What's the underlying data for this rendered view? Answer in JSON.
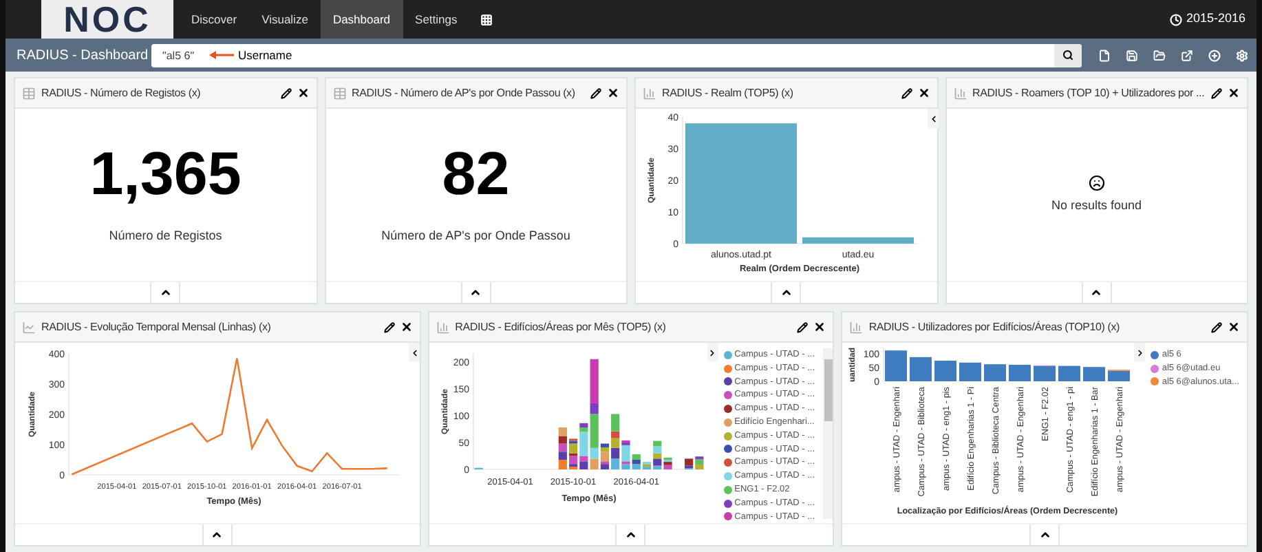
{
  "nav": {
    "logo": "NOC",
    "items": [
      {
        "label": "Discover",
        "selected": false
      },
      {
        "label": "Visualize",
        "selected": false
      },
      {
        "label": "Dashboard",
        "selected": true
      },
      {
        "label": "Settings",
        "selected": false
      }
    ],
    "time_range": "2015-2016"
  },
  "toolbar": {
    "title": "RADIUS - Dashboard",
    "search_value": "\"al5 6\"",
    "annotation": "Username"
  },
  "panels": [
    {
      "kind": "metric",
      "title": "RADIUS - Número de Registos (x)",
      "value": "1,365",
      "label": "Número de Registos"
    },
    {
      "kind": "metric",
      "title": "RADIUS - Número de AP's por Onde Passou (x)",
      "value": "82",
      "label": "Número de AP's por Onde Passou"
    },
    {
      "kind": "bar",
      "title": "RADIUS - Realm (TOP5) (x)",
      "chart_data": {
        "type": "bar",
        "xlabel": "Realm (Ordem Decrescente)",
        "ylabel": "Quantidade",
        "categories": [
          "alunos.utad.pt",
          "utad.eu"
        ],
        "values": [
          38,
          2
        ],
        "ylim": [
          0,
          40
        ],
        "yticks": [
          0,
          10,
          20,
          30,
          40
        ]
      }
    },
    {
      "kind": "empty",
      "title": "RADIUS - Roamers (TOP 10) + Utilizadores por ...",
      "message": "No results found"
    },
    {
      "kind": "line",
      "title": "RADIUS - Evolução Temporal Mensal (Linhas) (x)",
      "chart_data": {
        "type": "line",
        "xlabel": "Tempo (Mês)",
        "ylabel": "Quantidade",
        "categories": [
          null,
          null,
          null,
          "2015-04-01",
          null,
          null,
          "2015-07-01",
          null,
          null,
          "2015-10-01",
          null,
          null,
          "2016-01-01",
          null,
          null,
          "2016-04-01",
          null,
          null,
          "2016-07-01",
          null,
          null,
          null
        ],
        "values": [
          2,
          null,
          null,
          null,
          null,
          null,
          null,
          null,
          170,
          110,
          135,
          385,
          88,
          182,
          97,
          30,
          12,
          72,
          20,
          20,
          20,
          22
        ],
        "ylim": [
          0,
          400
        ],
        "yticks": [
          0,
          100,
          200,
          300,
          400
        ]
      }
    },
    {
      "kind": "time_bars",
      "title": "RADIUS - Edifícios/Áreas por Mês (TOP5) (x)",
      "chart_data": {
        "type": "bar",
        "stacked": true,
        "xlabel": "Tempo (Mês)",
        "ylabel": "Quantidade",
        "categories": [
          null,
          null,
          null,
          "2015-04-01",
          null,
          null,
          null,
          null,
          null,
          "2015-10-01",
          null,
          null,
          null,
          null,
          null,
          "2016-04-01",
          null,
          null,
          null,
          null,
          null,
          null
        ],
        "ylim": [
          0,
          215
        ],
        "yticks": [
          0,
          50,
          100,
          150,
          200
        ],
        "series": [
          {
            "name": "Campus - UTAD - ...",
            "color": "#5ab4d6",
            "values": [
              3,
              0,
              0,
              0,
              0,
              0,
              0,
              0,
              0,
              0,
              0,
              0,
              0,
              20,
              10,
              10,
              5,
              7,
              0,
              0,
              2,
              0
            ]
          },
          {
            "name": "Campus - UTAD - ...",
            "color": "#f07d2d",
            "values": [
              0,
              0,
              0,
              0,
              0,
              0,
              0,
              0,
              18,
              5,
              0,
              0,
              0,
              0,
              0,
              0,
              0,
              0,
              0,
              0,
              0,
              0
            ]
          },
          {
            "name": "Campus - UTAD - ...",
            "color": "#5b3fa8",
            "values": [
              0,
              0,
              0,
              0,
              0,
              0,
              0,
              0,
              15,
              5,
              15,
              0,
              10,
              20,
              0,
              0,
              0,
              13,
              0,
              0,
              5,
              0
            ]
          },
          {
            "name": "Campus - UTAD - ...",
            "color": "#c94fc0",
            "values": [
              0,
              0,
              0,
              0,
              0,
              0,
              0,
              0,
              15,
              15,
              10,
              0,
              5,
              0,
              5,
              0,
              0,
              0,
              8,
              0,
              0,
              0
            ]
          },
          {
            "name": "Campus - UTAD - ...",
            "color": "#9e2a2a",
            "values": [
              0,
              0,
              0,
              0,
              0,
              0,
              0,
              0,
              14,
              5,
              0,
              0,
              0,
              0,
              0,
              0,
              0,
              0,
              6,
              0,
              13,
              0
            ]
          },
          {
            "name": "Edifício Engenhari...",
            "color": "#e0a060",
            "values": [
              0,
              0,
              0,
              0,
              0,
              0,
              0,
              0,
              16,
              0,
              0,
              20,
              18,
              0,
              0,
              0,
              0,
              0,
              0,
              0,
              0,
              0
            ]
          },
          {
            "name": "Campus - UTAD - ...",
            "color": "#b5b02e",
            "values": [
              0,
              0,
              0,
              0,
              0,
              0,
              0,
              0,
              0,
              18,
              0,
              0,
              8,
              18,
              0,
              0,
              4,
              10,
              0,
              0,
              0,
              9
            ]
          },
          {
            "name": "Campus - UTAD - ...",
            "color": "#3a4fb0",
            "values": [
              0,
              0,
              0,
              0,
              0,
              0,
              0,
              0,
              0,
              5,
              0,
              0,
              7,
              0,
              0,
              8,
              0,
              0,
              0,
              0,
              0,
              0
            ]
          },
          {
            "name": "Campus - UTAD - ...",
            "color": "#d0503a",
            "values": [
              0,
              0,
              0,
              0,
              0,
              0,
              0,
              0,
              0,
              4,
              0,
              0,
              0,
              13,
              0,
              0,
              0,
              0,
              0,
              0,
              0,
              0
            ]
          },
          {
            "name": "Campus - UTAD - ...",
            "color": "#7fd6e6",
            "values": [
              0,
              0,
              0,
              0,
              0,
              0,
              0,
              0,
              0,
              0,
              45,
              20,
              0,
              0,
              30,
              0,
              5,
              13,
              4,
              0,
              0,
              0
            ]
          },
          {
            "name": "ENG1 - F2.02",
            "color": "#5cc05c",
            "values": [
              0,
              0,
              0,
              0,
              0,
              0,
              0,
              0,
              0,
              0,
              8,
              63,
              0,
              32,
              0,
              10,
              0,
              10,
              4,
              0,
              0,
              10
            ]
          },
          {
            "name": "Campus - UTAD - ...",
            "color": "#7b3fbf",
            "values": [
              0,
              0,
              0,
              0,
              0,
              0,
              0,
              0,
              0,
              0,
              8,
              20,
              0,
              0,
              5,
              0,
              0,
              0,
              0,
              0,
              0,
              5
            ]
          },
          {
            "name": "Campus - UTAD - ...",
            "color": "#c83cae",
            "values": [
              0,
              0,
              0,
              0,
              0,
              0,
              0,
              0,
              0,
              0,
              0,
              82,
              0,
              0,
              4,
              0,
              0,
              0,
              0,
              0,
              0,
              0
            ]
          }
        ]
      }
    },
    {
      "kind": "category_bars",
      "title": "RADIUS - Utilizadores por Edifícios/Áreas (TOP10) (x)",
      "chart_data": {
        "type": "bar",
        "stacked": true,
        "xlabel": "Localização por Edifícios/Áreas (Ordem Decrescente)",
        "ylabel": "uantidad",
        "categories": [
          "ampus - UTAD - Engenhari",
          "Campus - UTAD - Biblioteca",
          "ampus - UTAD - eng1 - pis",
          "Edifício Engenharias 1 - Pi",
          "Campus - Biblioteca Centra",
          "ampus - UTAD - Engenhari",
          "ENG1 - F2.02",
          "Campus - UTAD - eng1 - pi",
          "Edifício Engenharias 1 - Bar",
          "ampus - UTAD - Engenhari"
        ],
        "ylim": [
          0,
          120
        ],
        "yticks": [
          0,
          50,
          100
        ],
        "series": [
          {
            "name": "al5 6",
            "color": "#3f7cc0",
            "values": [
              112,
              88,
              75,
              68,
              62,
              60,
              56,
              56,
              52,
              38
            ]
          },
          {
            "name": "al5 6@utad.eu",
            "color": "#d87ad8",
            "values": [
              0,
              0,
              0,
              0,
              0,
              0,
              2,
              0,
              0,
              0
            ]
          },
          {
            "name": "al5 6@alunos.uta...",
            "color": "#f0883a",
            "values": [
              0,
              0,
              0,
              0,
              0,
              0,
              0,
              0,
              0,
              4
            ]
          }
        ]
      }
    }
  ]
}
